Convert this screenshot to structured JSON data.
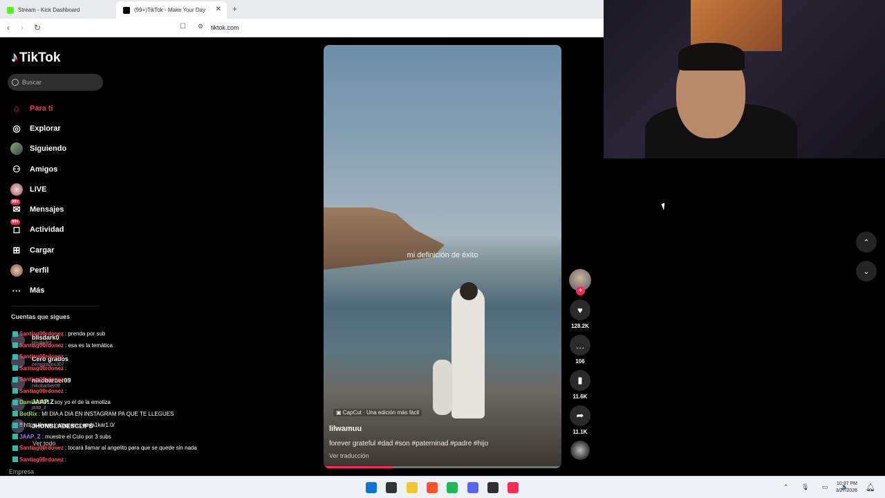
{
  "browser": {
    "tabs": [
      {
        "title": "Stream - Kick Dashboard",
        "color": "#53fc18"
      },
      {
        "title": "(99+)TikTok - Make Your Day",
        "color": "#000000"
      }
    ],
    "url": "tiktok.com"
  },
  "tiktok": {
    "logo": "TikTok",
    "search_placeholder": "Buscar",
    "nav": [
      {
        "label": "Para ti",
        "icon": "home-icon",
        "glyph": "⌂"
      },
      {
        "label": "Explorar",
        "icon": "compass-icon",
        "glyph": "◎"
      },
      {
        "label": "Siguiendo",
        "icon": "following-avatar-icon",
        "glyph": ""
      },
      {
        "label": "Amigos",
        "icon": "friends-icon",
        "glyph": "⚇"
      },
      {
        "label": "LIVE",
        "icon": "live-icon",
        "glyph": "●"
      },
      {
        "label": "Mensajes",
        "icon": "messages-icon",
        "glyph": "✉",
        "badge": "99+"
      },
      {
        "label": "Actividad",
        "icon": "activity-icon",
        "glyph": "◻",
        "badge": "99+"
      },
      {
        "label": "Cargar",
        "icon": "upload-icon",
        "glyph": "⊞"
      },
      {
        "label": "Perfil",
        "icon": "profile-icon",
        "glyph": ""
      },
      {
        "label": "Más",
        "icon": "more-icon",
        "glyph": "···"
      }
    ],
    "following_header": "Cuentas que sigues",
    "following": [
      {
        "name": "blisdark0",
        "handle": "blisdark0"
      },
      {
        "name": "Cero grados",
        "handle": "cerogrados307"
      },
      {
        "name": "nikobarber09",
        "handle": "nikobarber09"
      },
      {
        "name": "JAAP Z",
        "handle": "jaap_z"
      },
      {
        "name": "JHONBLADESCLIPS",
        "handle": ""
      }
    ],
    "see_all": "Ver todo",
    "footer": "Empresa"
  },
  "chat": [
    {
      "user": "Santiag00rdonez",
      "color": "#ff4d6a",
      "text": ": prenda por sub"
    },
    {
      "user": "Santiag00rdonez",
      "color": "#ff4d6a",
      "text": ": esa es la temática"
    },
    {
      "user": "Santiag00rdonez",
      "color": "#ff4d6a",
      "text": ":"
    },
    {
      "user": "Santiag00rdonez",
      "color": "#ff4d6a",
      "text": ":"
    },
    {
      "user": "Santiag00rdonez",
      "color": "#ff4d6a",
      "text": ":"
    },
    {
      "user": "Santiag00rdonez",
      "color": "#ff4d6a",
      "text": ":"
    },
    {
      "user": "DamianFC1",
      "color": "#9be04a",
      "text": ": soy yo el de la emotiza"
    },
    {
      "user": "BotRix",
      "color": "#9be04a",
      "text": ": MI DIA A DIA EN INSTAGRAM PA QUE TE LLEGUES"
    },
    {
      "user": "",
      "color": "#ffffff",
      "text": "!! https://www.instagram.com/a1kar1.0/"
    },
    {
      "user": "JAAP_Z",
      "color": "#b06cff",
      "text": ": muestre el Culo por 3 subs"
    },
    {
      "user": "Santiag00rdonez",
      "color": "#ff4d6a",
      "text": ": tocará llamar al angelito para que se quede sin nada"
    },
    {
      "user": "Santiag00rdonez",
      "color": "#ff4d6a",
      "text": ":"
    }
  ],
  "video": {
    "overlay_text": "mi definición de éxito",
    "capcut": "CapCut · Una edición más fácil",
    "username": "lilwamuu",
    "description": "forever grateful #dad #son #paterninad #padre #hijo",
    "translate": "Ver traducción",
    "progress": 0.29
  },
  "actions": {
    "likes": "128.2K",
    "comments": "106",
    "saves": "11.6K",
    "shares": "11.1K"
  },
  "taskbar": {
    "time": "10:37 PM",
    "date": "3/27/2026",
    "apps": [
      {
        "name": "windows-start-icon",
        "color": "#0a74da"
      },
      {
        "name": "search-icon",
        "color": "#333333"
      },
      {
        "name": "file-explorer-icon",
        "color": "#f4c430"
      },
      {
        "name": "brave-browser-icon",
        "color": "#fb542b"
      },
      {
        "name": "spotify-icon",
        "color": "#1db954"
      },
      {
        "name": "discord-icon",
        "color": "#5865f2"
      },
      {
        "name": "obs-icon",
        "color": "#302e31"
      },
      {
        "name": "tiktok-app-icon",
        "color": "#fe2c55"
      }
    ]
  }
}
